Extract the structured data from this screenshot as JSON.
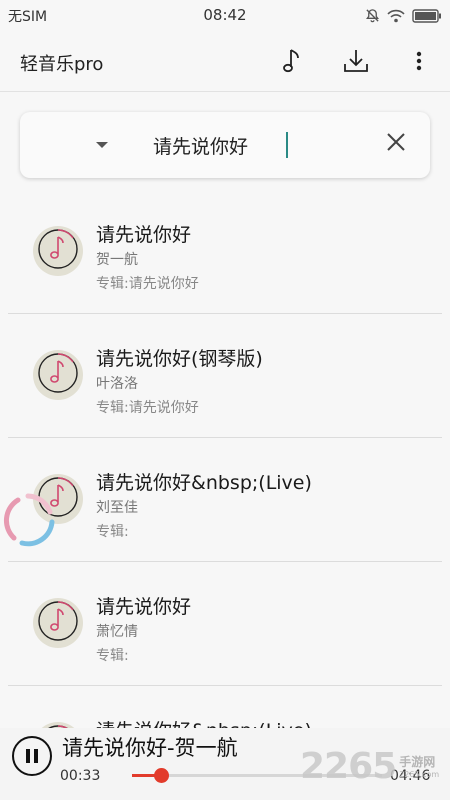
{
  "status_bar": {
    "carrier": "无SIM",
    "time": "08:42"
  },
  "app_bar": {
    "title": "轻音乐pro"
  },
  "search": {
    "query": "请先说你好"
  },
  "songs": [
    {
      "title": "请先说你好",
      "artist": "贺一航",
      "album": "专辑:请先说你好"
    },
    {
      "title": "请先说你好(钢琴版)",
      "artist": "叶洛洛",
      "album": "专辑:请先说你好"
    },
    {
      "title": "请先说你好&nbsp;(Live)",
      "artist": "刘至佳",
      "album": "专辑:"
    },
    {
      "title": "请先说你好",
      "artist": "萧忆情",
      "album": "专辑:"
    },
    {
      "title": "请先说你好&nbsp;(Live)",
      "artist": "",
      "album": ""
    }
  ],
  "player": {
    "now_playing": "请先说你好-贺一航",
    "current_time": "00:33",
    "total_time": "04:46",
    "progress": 0.115
  },
  "watermark": {
    "number": "2265",
    "brand": "手游网",
    "url": "2265.com"
  },
  "colors": {
    "accent": "#e23b2b",
    "caret": "#2a8a85",
    "cover": "#e2e0d3"
  }
}
